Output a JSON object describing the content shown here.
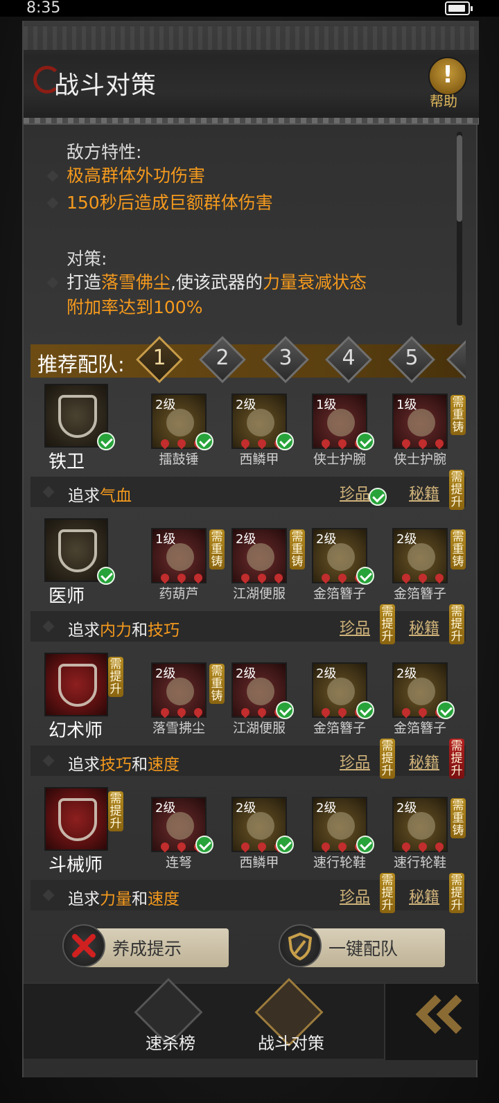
{
  "status_bar": {
    "time": "8:35"
  },
  "header": {
    "title": "战斗对策",
    "help_label": "帮助",
    "help_symbol": "!"
  },
  "info": {
    "enemy_title": "敌方特性:",
    "enemy_traits": [
      "极高群体外功伤害",
      "150秒后造成巨额群体伤害"
    ],
    "strategy_title": "对策:",
    "strategy_parts": [
      "打造",
      "落雪佛尘",
      ",使该武器的",
      "力量衰减状态",
      "附加率达到100%"
    ]
  },
  "recommend": {
    "label": "推荐配队:",
    "tabs": [
      "1",
      "2",
      "3",
      "4",
      "5"
    ],
    "active_tab": "1"
  },
  "rows": [
    {
      "class_name": "铁卫",
      "class_status": "check",
      "equipment": [
        {
          "level": "2级",
          "name": "擂鼓锤",
          "status": "check",
          "frame": "gold"
        },
        {
          "level": "2级",
          "name": "西鳞甲",
          "status": "check",
          "frame": "gold"
        },
        {
          "level": "1级",
          "name": "侠士护腕",
          "status": "check",
          "frame": "red"
        },
        {
          "level": "1级",
          "name": "侠士护腕",
          "status": "需重铸",
          "frame": "red"
        }
      ],
      "pursue_prefix": "追求",
      "pursue_a": "气血",
      "pursue_and": "",
      "pursue_b": "",
      "treasure_label": "珍品",
      "treasure_status": "check",
      "secret_label": "秘籍",
      "secret_status": "需提升"
    },
    {
      "class_name": "医师",
      "class_status": "check",
      "equipment": [
        {
          "level": "1级",
          "name": "药葫芦",
          "status": "需重铸",
          "frame": "red"
        },
        {
          "level": "2级",
          "name": "江湖便服",
          "status": "需重铸",
          "frame": "red"
        },
        {
          "level": "2级",
          "name": "金箔簪子",
          "status": "check",
          "frame": "gold"
        },
        {
          "level": "2级",
          "name": "金箔簪子",
          "status": "需重铸",
          "frame": "gold"
        }
      ],
      "pursue_prefix": "追求",
      "pursue_a": "内力",
      "pursue_and": "和",
      "pursue_b": "技巧",
      "treasure_label": "珍品",
      "treasure_status": "需提升",
      "secret_label": "秘籍",
      "secret_status": "需提升"
    },
    {
      "class_name": "幻术师",
      "class_status": "需提升",
      "equipment": [
        {
          "level": "2级",
          "name": "落雪拂尘",
          "status": "需重铸",
          "frame": "red"
        },
        {
          "level": "2级",
          "name": "江湖便服",
          "status": "check",
          "frame": "red"
        },
        {
          "level": "2级",
          "name": "金箔簪子",
          "status": "check",
          "frame": "gold"
        },
        {
          "level": "2级",
          "name": "金箔簪子",
          "status": "check",
          "frame": "gold"
        }
      ],
      "pursue_prefix": "追求",
      "pursue_a": "技巧",
      "pursue_and": "和",
      "pursue_b": "速度",
      "treasure_label": "珍品",
      "treasure_status": "需提升",
      "secret_label": "秘籍",
      "secret_status": "需提升",
      "secret_status_color": "red"
    },
    {
      "class_name": "斗械师",
      "class_status": "需提升",
      "equipment": [
        {
          "level": "2级",
          "name": "连弩",
          "status": "check",
          "frame": "red"
        },
        {
          "level": "2级",
          "name": "西鳞甲",
          "status": "check",
          "frame": "gold"
        },
        {
          "level": "2级",
          "name": "速行轮鞋",
          "status": "check",
          "frame": "gold"
        },
        {
          "level": "2级",
          "name": "速行轮鞋",
          "status": "需重铸",
          "frame": "gold"
        }
      ],
      "pursue_prefix": "追求",
      "pursue_a": "力量",
      "pursue_and": "和",
      "pursue_b": "速度",
      "treasure_label": "珍品",
      "treasure_status": "需提升",
      "secret_label": "秘籍",
      "secret_status": "需提升"
    }
  ],
  "buttons": {
    "training_hint": "养成提示",
    "one_click": "一键配队"
  },
  "nav": {
    "items": [
      "速杀榜",
      "战斗对策"
    ],
    "active": "战斗对策"
  },
  "colors": {
    "accent_orange": "#f59a1d",
    "gold_tag": "#b48a1f",
    "red_tag": "#b42020",
    "check_green": "#27a33a"
  }
}
